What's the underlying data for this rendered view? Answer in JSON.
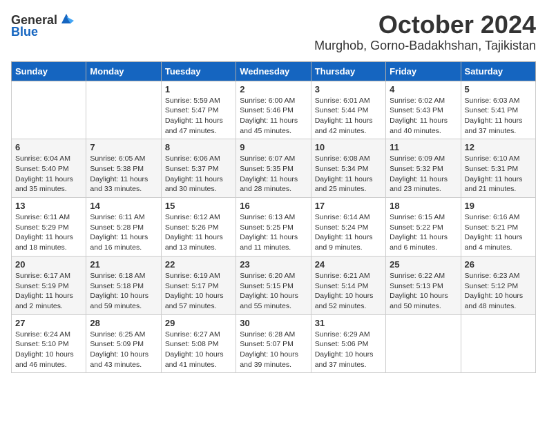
{
  "header": {
    "logo_general": "General",
    "logo_blue": "Blue",
    "month_title": "October 2024",
    "location": "Murghob, Gorno-Badakhshan, Tajikistan"
  },
  "days_of_week": [
    "Sunday",
    "Monday",
    "Tuesday",
    "Wednesday",
    "Thursday",
    "Friday",
    "Saturday"
  ],
  "weeks": [
    [
      {
        "day": "",
        "info": ""
      },
      {
        "day": "",
        "info": ""
      },
      {
        "day": "1",
        "info": "Sunrise: 5:59 AM\nSunset: 5:47 PM\nDaylight: 11 hours and 47 minutes."
      },
      {
        "day": "2",
        "info": "Sunrise: 6:00 AM\nSunset: 5:46 PM\nDaylight: 11 hours and 45 minutes."
      },
      {
        "day": "3",
        "info": "Sunrise: 6:01 AM\nSunset: 5:44 PM\nDaylight: 11 hours and 42 minutes."
      },
      {
        "day": "4",
        "info": "Sunrise: 6:02 AM\nSunset: 5:43 PM\nDaylight: 11 hours and 40 minutes."
      },
      {
        "day": "5",
        "info": "Sunrise: 6:03 AM\nSunset: 5:41 PM\nDaylight: 11 hours and 37 minutes."
      }
    ],
    [
      {
        "day": "6",
        "info": "Sunrise: 6:04 AM\nSunset: 5:40 PM\nDaylight: 11 hours and 35 minutes."
      },
      {
        "day": "7",
        "info": "Sunrise: 6:05 AM\nSunset: 5:38 PM\nDaylight: 11 hours and 33 minutes."
      },
      {
        "day": "8",
        "info": "Sunrise: 6:06 AM\nSunset: 5:37 PM\nDaylight: 11 hours and 30 minutes."
      },
      {
        "day": "9",
        "info": "Sunrise: 6:07 AM\nSunset: 5:35 PM\nDaylight: 11 hours and 28 minutes."
      },
      {
        "day": "10",
        "info": "Sunrise: 6:08 AM\nSunset: 5:34 PM\nDaylight: 11 hours and 25 minutes."
      },
      {
        "day": "11",
        "info": "Sunrise: 6:09 AM\nSunset: 5:32 PM\nDaylight: 11 hours and 23 minutes."
      },
      {
        "day": "12",
        "info": "Sunrise: 6:10 AM\nSunset: 5:31 PM\nDaylight: 11 hours and 21 minutes."
      }
    ],
    [
      {
        "day": "13",
        "info": "Sunrise: 6:11 AM\nSunset: 5:29 PM\nDaylight: 11 hours and 18 minutes."
      },
      {
        "day": "14",
        "info": "Sunrise: 6:11 AM\nSunset: 5:28 PM\nDaylight: 11 hours and 16 minutes."
      },
      {
        "day": "15",
        "info": "Sunrise: 6:12 AM\nSunset: 5:26 PM\nDaylight: 11 hours and 13 minutes."
      },
      {
        "day": "16",
        "info": "Sunrise: 6:13 AM\nSunset: 5:25 PM\nDaylight: 11 hours and 11 minutes."
      },
      {
        "day": "17",
        "info": "Sunrise: 6:14 AM\nSunset: 5:24 PM\nDaylight: 11 hours and 9 minutes."
      },
      {
        "day": "18",
        "info": "Sunrise: 6:15 AM\nSunset: 5:22 PM\nDaylight: 11 hours and 6 minutes."
      },
      {
        "day": "19",
        "info": "Sunrise: 6:16 AM\nSunset: 5:21 PM\nDaylight: 11 hours and 4 minutes."
      }
    ],
    [
      {
        "day": "20",
        "info": "Sunrise: 6:17 AM\nSunset: 5:19 PM\nDaylight: 11 hours and 2 minutes."
      },
      {
        "day": "21",
        "info": "Sunrise: 6:18 AM\nSunset: 5:18 PM\nDaylight: 10 hours and 59 minutes."
      },
      {
        "day": "22",
        "info": "Sunrise: 6:19 AM\nSunset: 5:17 PM\nDaylight: 10 hours and 57 minutes."
      },
      {
        "day": "23",
        "info": "Sunrise: 6:20 AM\nSunset: 5:15 PM\nDaylight: 10 hours and 55 minutes."
      },
      {
        "day": "24",
        "info": "Sunrise: 6:21 AM\nSunset: 5:14 PM\nDaylight: 10 hours and 52 minutes."
      },
      {
        "day": "25",
        "info": "Sunrise: 6:22 AM\nSunset: 5:13 PM\nDaylight: 10 hours and 50 minutes."
      },
      {
        "day": "26",
        "info": "Sunrise: 6:23 AM\nSunset: 5:12 PM\nDaylight: 10 hours and 48 minutes."
      }
    ],
    [
      {
        "day": "27",
        "info": "Sunrise: 6:24 AM\nSunset: 5:10 PM\nDaylight: 10 hours and 46 minutes."
      },
      {
        "day": "28",
        "info": "Sunrise: 6:25 AM\nSunset: 5:09 PM\nDaylight: 10 hours and 43 minutes."
      },
      {
        "day": "29",
        "info": "Sunrise: 6:27 AM\nSunset: 5:08 PM\nDaylight: 10 hours and 41 minutes."
      },
      {
        "day": "30",
        "info": "Sunrise: 6:28 AM\nSunset: 5:07 PM\nDaylight: 10 hours and 39 minutes."
      },
      {
        "day": "31",
        "info": "Sunrise: 6:29 AM\nSunset: 5:06 PM\nDaylight: 10 hours and 37 minutes."
      },
      {
        "day": "",
        "info": ""
      },
      {
        "day": "",
        "info": ""
      }
    ]
  ]
}
